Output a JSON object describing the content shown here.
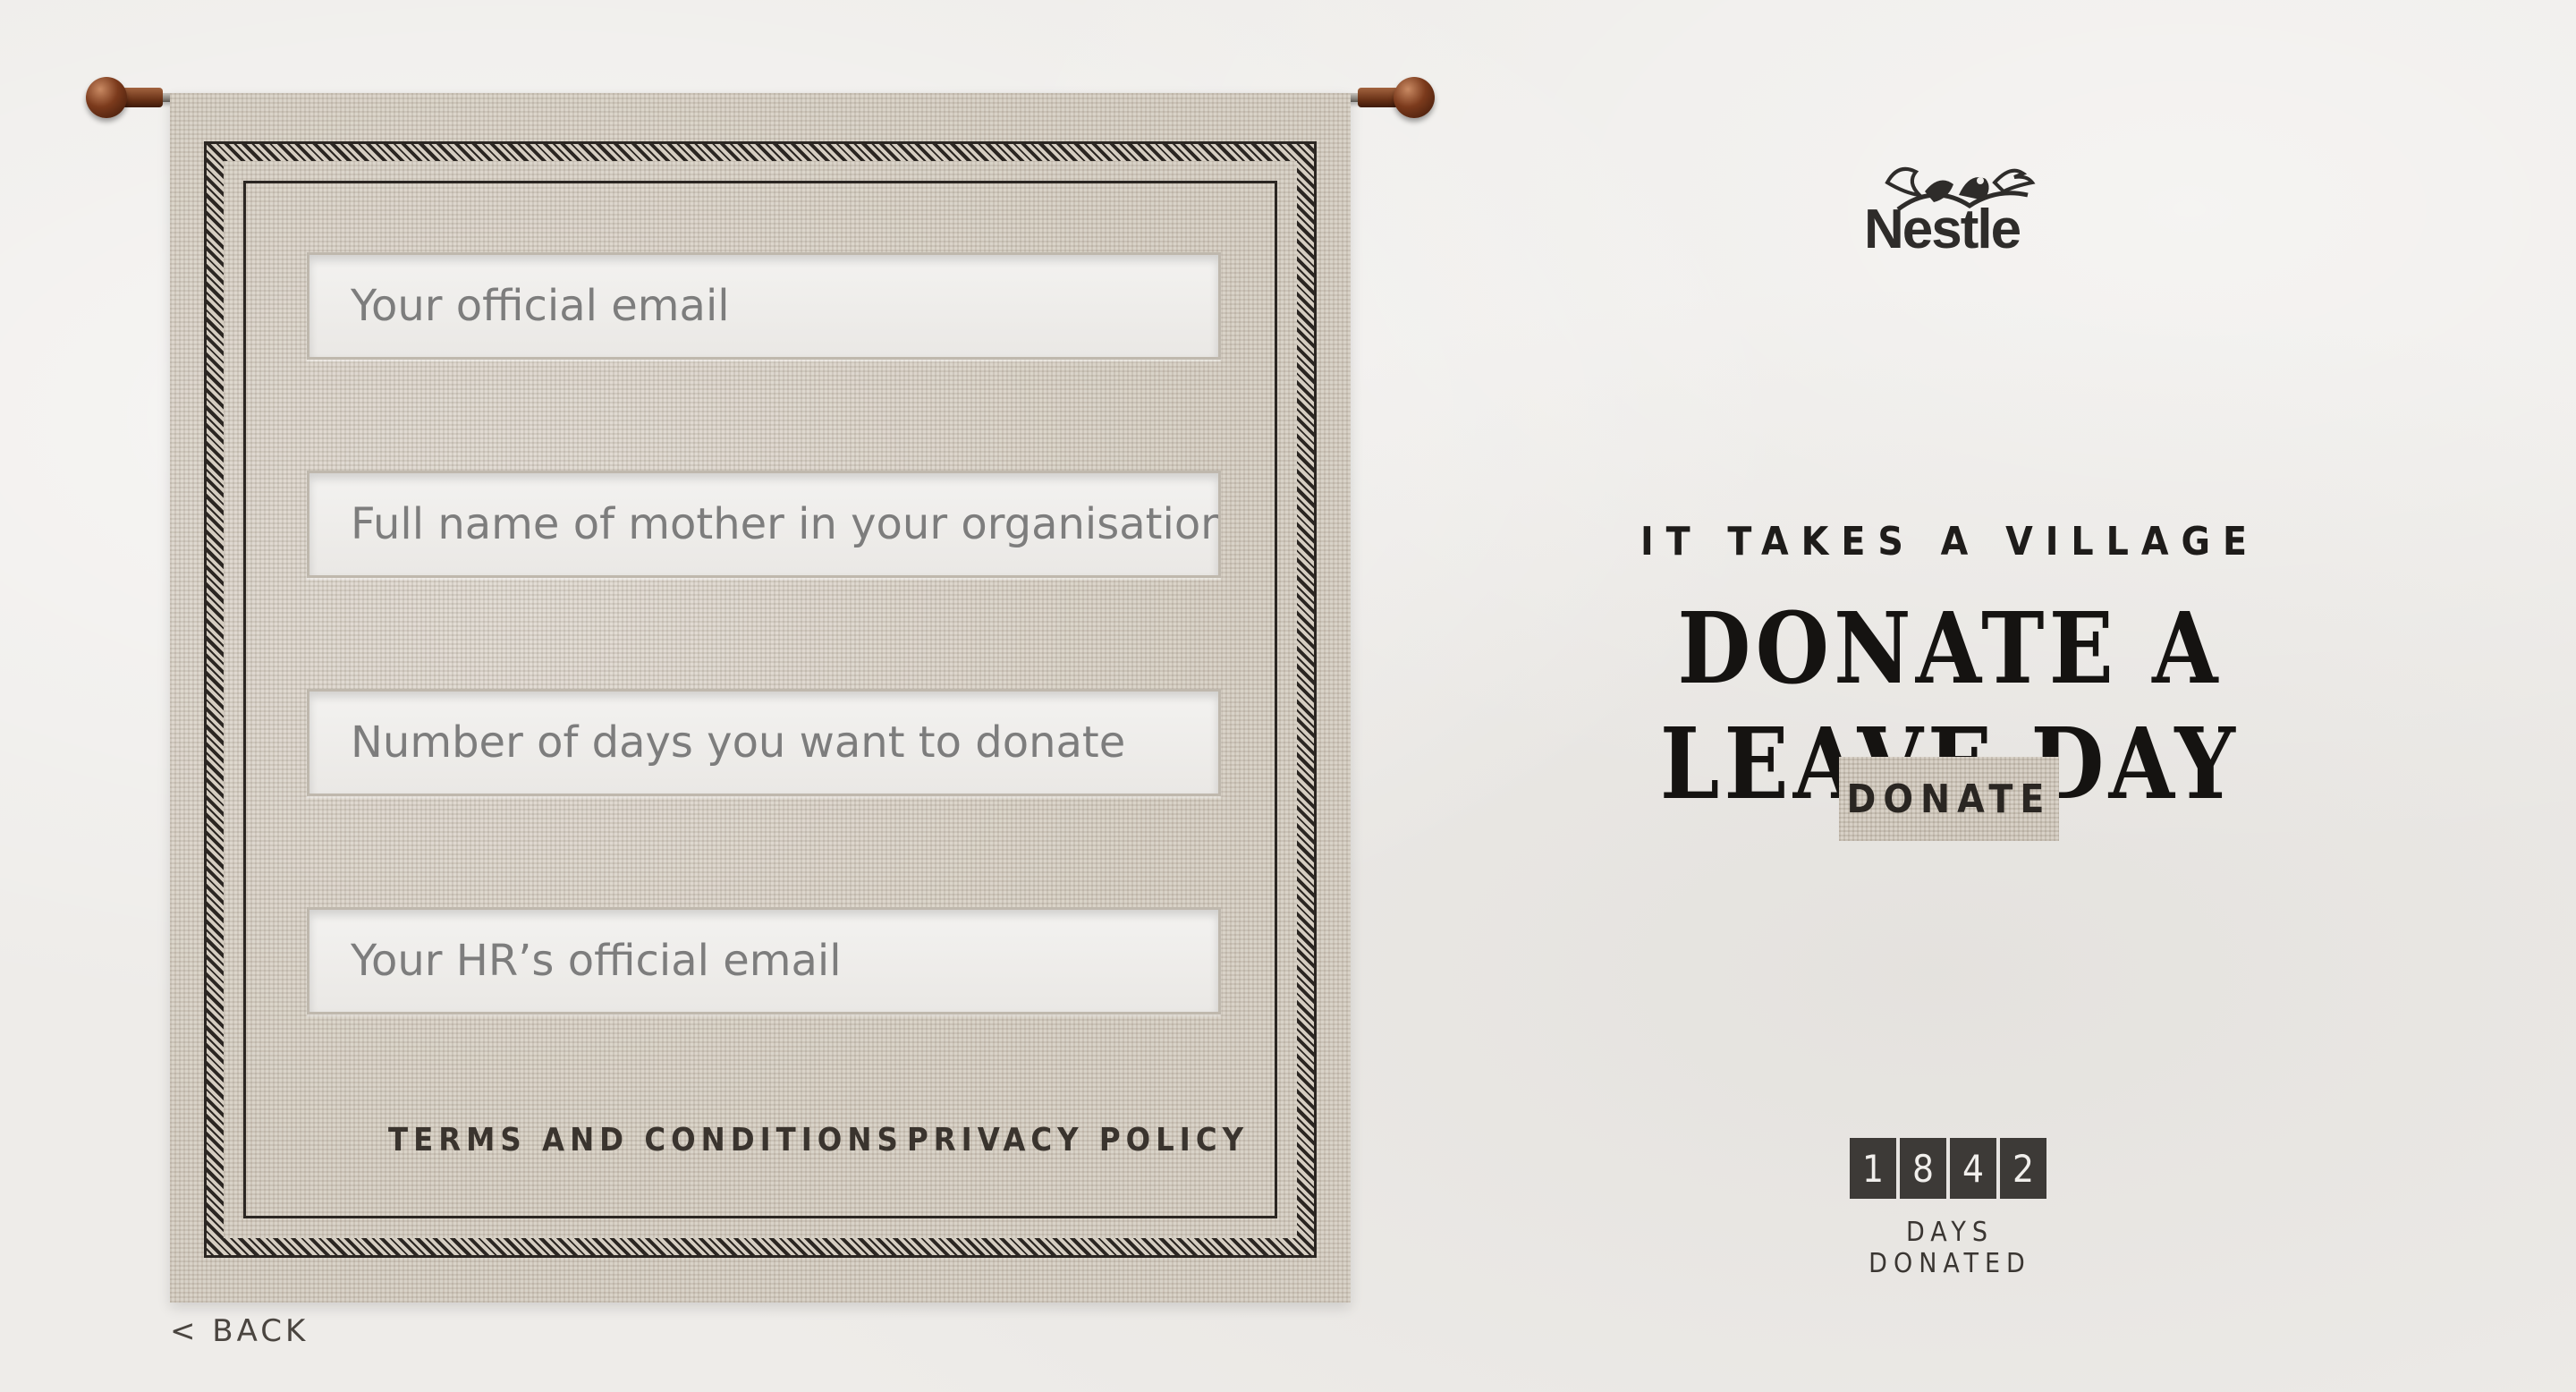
{
  "form": {
    "email_placeholder": "Your official email",
    "mother_name_placeholder": "Full name of mother in your organisation",
    "days_placeholder": "Number of days you want to donate",
    "hr_email_placeholder": "Your HR’s official email",
    "terms_label": "TERMS AND CONDITIONS",
    "privacy_label": "PRIVACY POLICY"
  },
  "nav": {
    "back_label": "< BACK"
  },
  "brand": {
    "logo_text": "Nestle"
  },
  "hero": {
    "tagline": "IT TAKES A VILLAGE",
    "headline": "DONATE A LEAVE DAY",
    "donate_button": "DONATE"
  },
  "counter": {
    "digits": [
      "1",
      "8",
      "4",
      "2"
    ],
    "label": "DAYS DONATED"
  }
}
